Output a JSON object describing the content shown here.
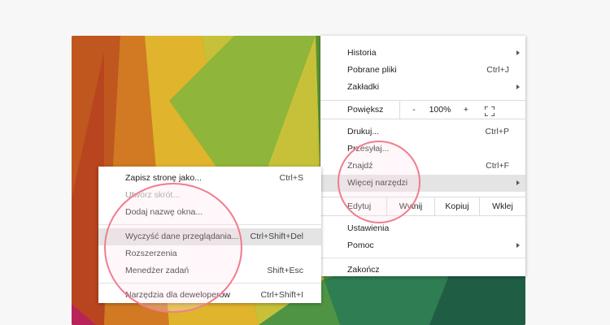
{
  "colors": {
    "highlight": "#e4e4e4",
    "circle": "#ef7d8d",
    "disabled_text": "#9a9a9a"
  },
  "main_menu": {
    "history": "Historia",
    "downloads": "Pobrane pliki",
    "downloads_shortcut": "Ctrl+J",
    "bookmarks": "Zakładki",
    "zoom": {
      "label": "Powiększ",
      "minus": "-",
      "value": "100%",
      "plus": "+"
    },
    "print": "Drukuj...",
    "print_shortcut": "Ctrl+P",
    "cast": "Przesyłaj...",
    "find": "Znajdź",
    "find_shortcut": "Ctrl+F",
    "more_tools": "Więcej narzędzi",
    "edit": {
      "label": "Edytuj",
      "cut": "Wytnij",
      "copy": "Kopiuj",
      "paste": "Wklej"
    },
    "settings": "Ustawienia",
    "help": "Pomoc",
    "exit": "Zakończ"
  },
  "sub_menu": {
    "save_page": "Zapisz stronę jako...",
    "save_page_shortcut": "Ctrl+S",
    "create_shortcut": "Utwórz skrót...",
    "name_window": "Dodaj nazwę okna...",
    "clear_data": "Wyczyść dane przeglądania...",
    "clear_data_shortcut": "Ctrl+Shift+Del",
    "extensions": "Rozszerzenia",
    "task_manager": "Menedżer zadań",
    "task_manager_shortcut": "Shift+Esc",
    "dev_tools": "Narzędzia dla deweloperów",
    "dev_tools_shortcut": "Ctrl+Shift+I"
  }
}
